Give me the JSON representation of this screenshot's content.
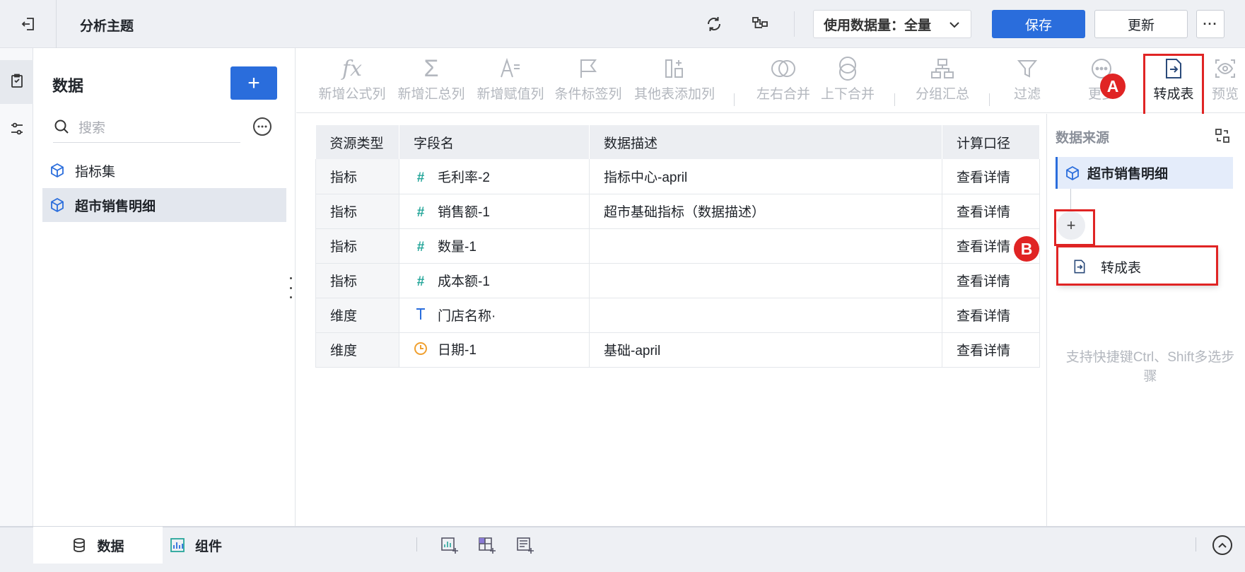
{
  "header": {
    "title": "分析主题",
    "usage_select": "使用数据量：全量",
    "save_label": "保存",
    "update_label": "更新"
  },
  "data_panel": {
    "title": "数据",
    "add_label": "+",
    "search_placeholder": "搜索",
    "items": [
      {
        "label": "指标集",
        "icon": "cube-icon"
      },
      {
        "label": "超市销售明细",
        "icon": "cube-icon",
        "selected": true
      }
    ]
  },
  "toolbar": {
    "tools": [
      {
        "label": "新增公式列",
        "icon": "formula-icon"
      },
      {
        "label": "新增汇总列",
        "icon": "sigma-icon"
      },
      {
        "label": "新增赋值列",
        "icon": "assign-icon"
      },
      {
        "label": "条件标签列",
        "icon": "flag-icon"
      },
      {
        "label": "其他表添加列",
        "icon": "add-column-icon"
      },
      {
        "label": "左右合并",
        "icon": "merge-horizontal-icon"
      },
      {
        "label": "上下合并",
        "icon": "merge-vertical-icon"
      },
      {
        "label": "分组汇总",
        "icon": "group-summary-icon"
      },
      {
        "label": "过滤",
        "icon": "filter-icon"
      },
      {
        "label": "更多",
        "icon": "more-circle-icon"
      },
      {
        "label": "转成表",
        "icon": "convert-table-icon"
      },
      {
        "label": "预览",
        "icon": "preview-icon"
      }
    ]
  },
  "table": {
    "columns": [
      "资源类型",
      "字段名",
      "数据描述",
      "计算口径"
    ],
    "rows": [
      {
        "type": "指标",
        "icon": "number-icon",
        "name": "毛利率-2",
        "desc": "指标中心-april",
        "link": "查看详情"
      },
      {
        "type": "指标",
        "icon": "number-icon",
        "name": "销售额-1",
        "desc": "超市基础指标（数据描述）",
        "link": "查看详情"
      },
      {
        "type": "指标",
        "icon": "number-icon",
        "name": "数量-1",
        "desc": "",
        "link": "查看详情"
      },
      {
        "type": "指标",
        "icon": "number-icon",
        "name": "成本额-1",
        "desc": "",
        "link": "查看详情"
      },
      {
        "type": "维度",
        "icon": "text-icon",
        "name": "门店名称·",
        "desc": "",
        "link": "查看详情"
      },
      {
        "type": "维度",
        "icon": "date-icon",
        "name": "日期-1",
        "desc": "基础-april",
        "link": "查看详情"
      }
    ]
  },
  "source_panel": {
    "title": "数据来源",
    "node_label": "超市销售明细",
    "add_label": "+",
    "menu_item": "转成表",
    "hint": "支持快捷键Ctrl、Shift多选步骤"
  },
  "annotations": {
    "a": "A",
    "b": "B"
  },
  "bottom": {
    "tab_data": "数据",
    "tab_component": "组件"
  },
  "colors": {
    "accent": "#2a6ddc",
    "annotation": "#e02424",
    "number_icon": "#26a69a",
    "date_icon": "#f0a030"
  }
}
